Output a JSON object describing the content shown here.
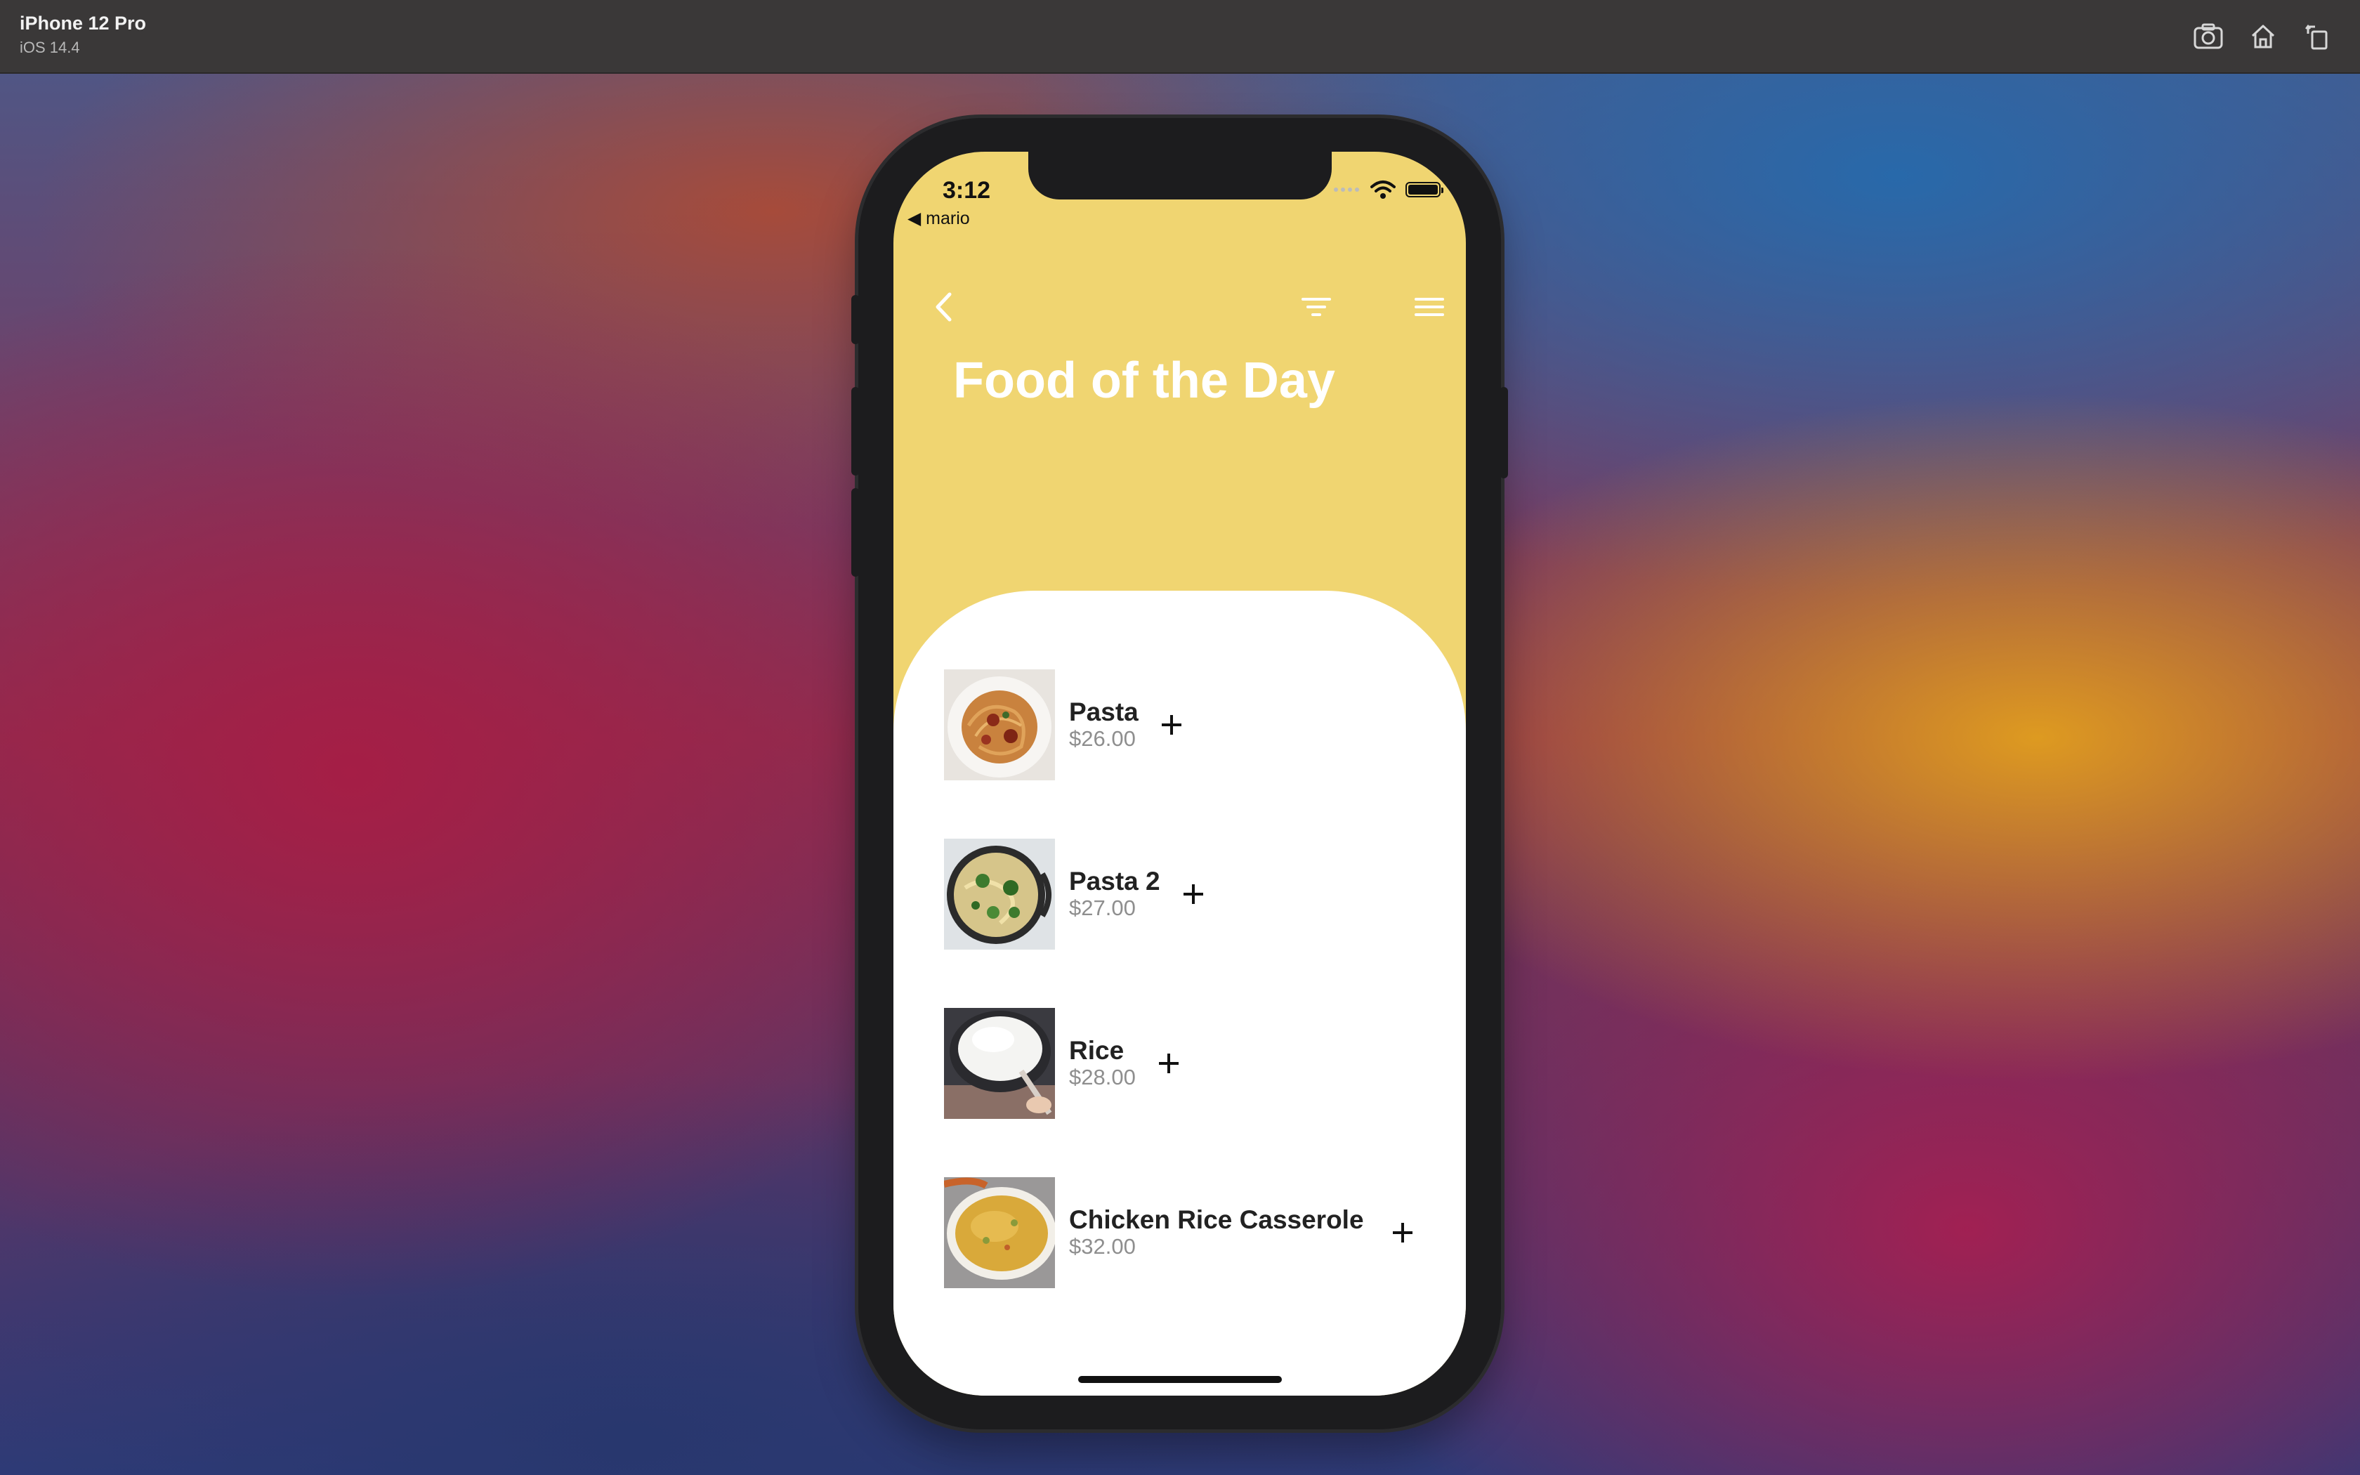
{
  "simulator": {
    "device_name": "iPhone 12 Pro",
    "os_version": "iOS 14.4",
    "icons": [
      "screenshot-icon",
      "home-icon",
      "rotate-icon"
    ]
  },
  "status_bar": {
    "time": "3:12",
    "back_to_app": "◀ mario"
  },
  "nav": {
    "icons": [
      "back-chevron-icon",
      "filter-icon",
      "menu-icon"
    ]
  },
  "page": {
    "title": "Food of the Day"
  },
  "foods": [
    {
      "name": "Pasta",
      "price": "$26.00",
      "image": "pasta-photo"
    },
    {
      "name": "Pasta 2",
      "price": "$27.00",
      "image": "pasta-2-photo"
    },
    {
      "name": "Rice",
      "price": "$28.00",
      "image": "rice-photo"
    },
    {
      "name": "Chicken Rice Casserole",
      "price": "$32.00",
      "image": "casserole-photo"
    }
  ],
  "colors": {
    "header_yellow": "#f0d571",
    "title_white": "#ffffff",
    "price_gray": "#8e8e8e",
    "sim_bar": "#3a3838"
  }
}
